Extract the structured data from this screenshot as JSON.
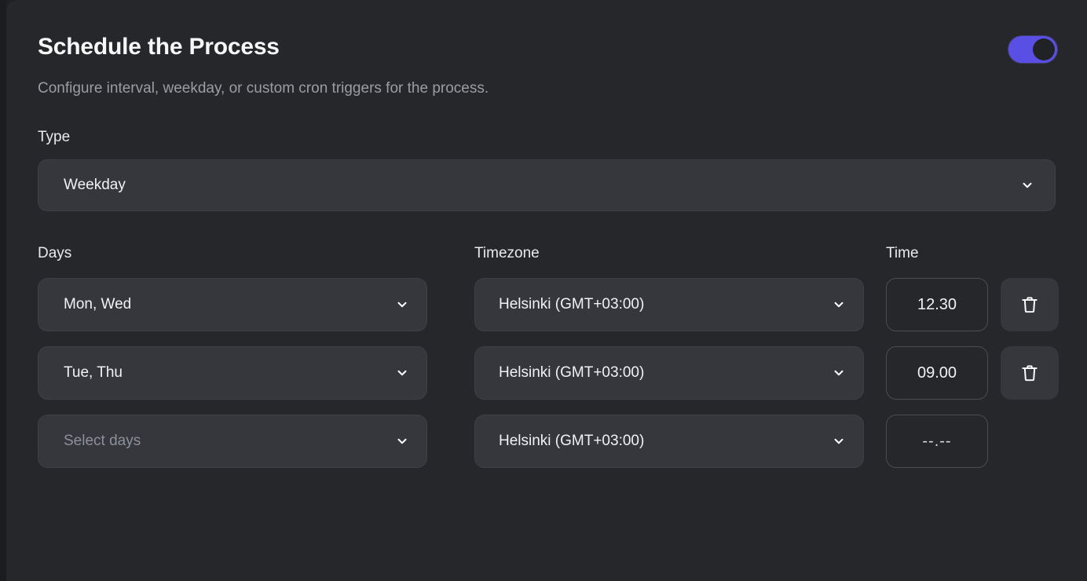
{
  "panel": {
    "title": "Schedule the Process",
    "subtitle": "Configure interval, weekday, or custom cron triggers for the process.",
    "enabled_toggle": {
      "state": "on",
      "track_color": "#5a4fe4",
      "knob_color": "#212226"
    }
  },
  "type_section": {
    "label": "Type",
    "selected": "Weekday",
    "chevron_icon": "chevron-down-icon"
  },
  "table": {
    "headers": {
      "days": "Days",
      "timezone": "Timezone",
      "time": "Time"
    },
    "rows": [
      {
        "days": "Mon, Wed",
        "days_is_placeholder": false,
        "timezone": "Helsinki (GMT+03:00)",
        "time": "12.30",
        "time_is_placeholder": false,
        "has_delete": true
      },
      {
        "days": "Tue, Thu",
        "days_is_placeholder": false,
        "timezone": "Helsinki (GMT+03:00)",
        "time": "09.00",
        "time_is_placeholder": false,
        "has_delete": true
      },
      {
        "days": "Select days",
        "days_is_placeholder": true,
        "timezone": "Helsinki (GMT+03:00)",
        "time": "--.--",
        "time_is_placeholder": true,
        "has_delete": false
      }
    ],
    "delete_icon": "trash-icon"
  },
  "colors": {
    "page_background": "#1f2023",
    "card_background": "#26272b",
    "field_background": "#35373c",
    "field_border": "#3e4045",
    "accent": "#5a4fe4",
    "text_primary": "#f2f2f4",
    "text_muted": "#9b9da3"
  }
}
